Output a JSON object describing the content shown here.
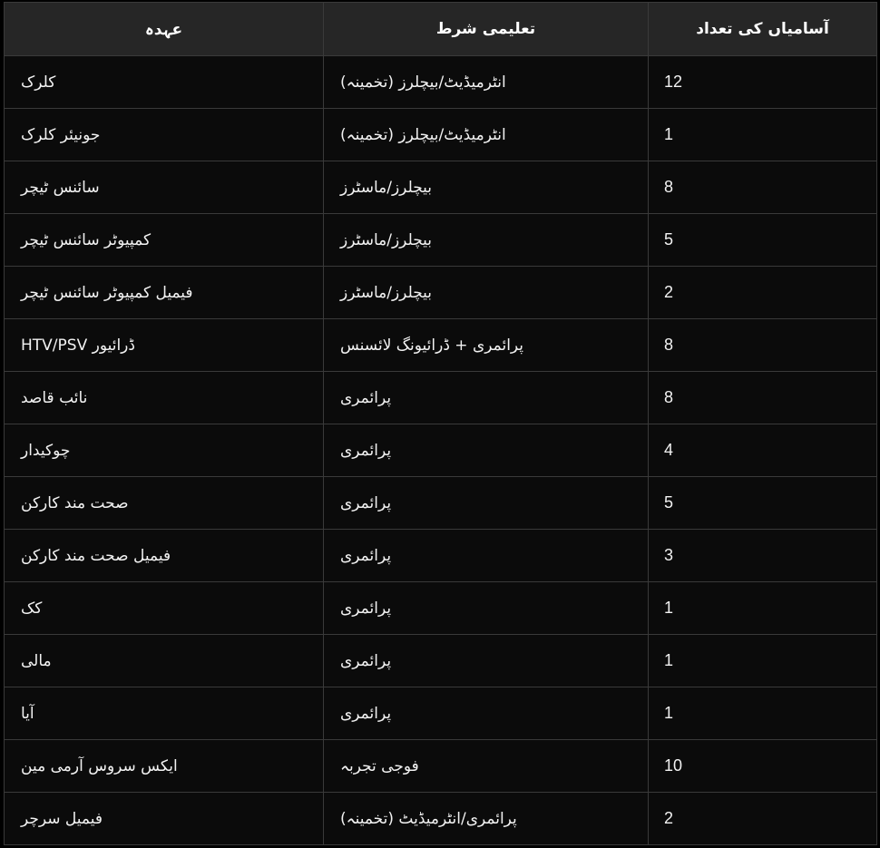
{
  "table": {
    "headers": [
      "عہدہ",
      "تعلیمی شرط",
      "آسامیاں کی تعداد"
    ],
    "rows": [
      {
        "post": "کلرک",
        "qualification": "انٹرمیڈیٹ/بیچلرز (تخمینہ)",
        "count": "12"
      },
      {
        "post": "جونیئر کلرک",
        "qualification": "انٹرمیڈیٹ/بیچلرز (تخمینہ)",
        "count": "1"
      },
      {
        "post": "سائنس ٹیچر",
        "qualification": "بیچلرز/ماسٹرز",
        "count": "8"
      },
      {
        "post": "کمپیوٹر سائنس ٹیچر",
        "qualification": "بیچلرز/ماسٹرز",
        "count": "5"
      },
      {
        "post": "فیمیل کمپیوٹر سائنس ٹیچر",
        "qualification": "بیچلرز/ماسٹرز",
        "count": "2"
      },
      {
        "post": "ڈرائیور HTV/PSV",
        "qualification": "پرائمری + ڈرائیونگ لائسنس",
        "count": "8"
      },
      {
        "post": "نائب قاصد",
        "qualification": "پرائمری",
        "count": "8"
      },
      {
        "post": "چوکیدار",
        "qualification": "پرائمری",
        "count": "4"
      },
      {
        "post": "صحت مند کارکن",
        "qualification": "پرائمری",
        "count": "5"
      },
      {
        "post": "فیمیل صحت مند کارکن",
        "qualification": "پرائمری",
        "count": "3"
      },
      {
        "post": "کک",
        "qualification": "پرائمری",
        "count": "1"
      },
      {
        "post": "مالی",
        "qualification": "پرائمری",
        "count": "1"
      },
      {
        "post": "آیا",
        "qualification": "پرائمری",
        "count": "1"
      },
      {
        "post": "ایکس سروس آرمی مین",
        "qualification": "فوجی تجربہ",
        "count": "10"
      },
      {
        "post": "فیمیل سرچر",
        "qualification": "پرائمری/انٹرمیڈیٹ (تخمینہ)",
        "count": "2"
      }
    ]
  },
  "colors": {
    "page_background": "#000000",
    "header_background": "#262626",
    "cell_background": "#0b0b0b",
    "border": "#3a3a3a",
    "text": "#f2f2f2"
  }
}
